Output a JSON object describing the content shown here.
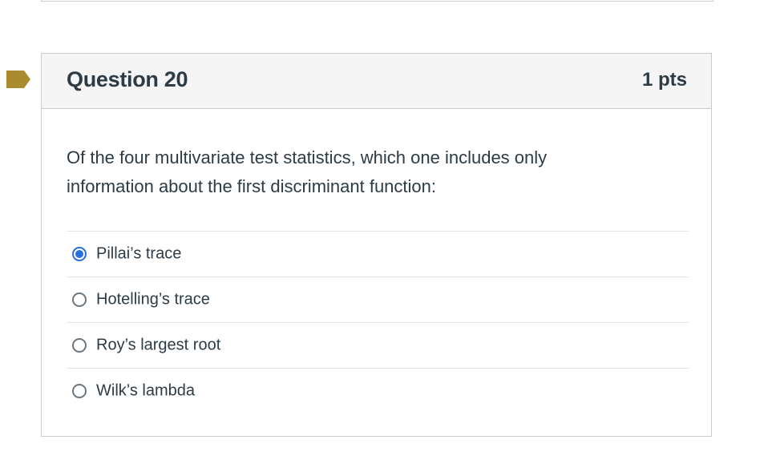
{
  "question": {
    "title": "Question 20",
    "points": "1 pts",
    "text": "Of the four multivariate test statistics, which one includes only information about the first discriminant function:",
    "flag_color": "#a98c2f"
  },
  "answers": [
    {
      "label": "Pillai’s trace",
      "selected": true
    },
    {
      "label": "Hotelling’s trace",
      "selected": false
    },
    {
      "label": "Roy’s largest root",
      "selected": false
    },
    {
      "label": "Wilk’s lambda",
      "selected": false
    }
  ],
  "colors": {
    "selected_radio": "#2a6fe0",
    "header_bg": "#f5f5f5",
    "border": "#c7cdd1",
    "text": "#2d3b45"
  }
}
